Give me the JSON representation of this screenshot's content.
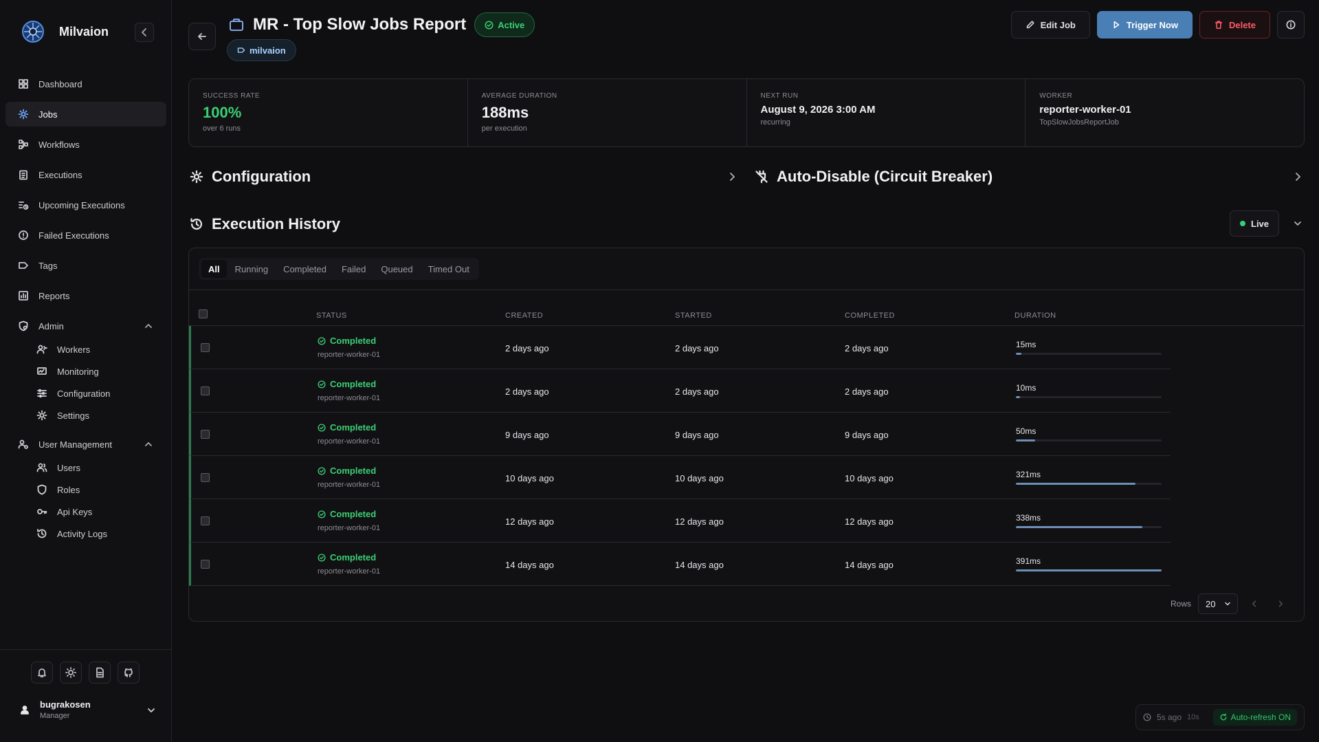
{
  "app": {
    "name": "Milvaion"
  },
  "sidebar": {
    "items": [
      {
        "label": "Dashboard"
      },
      {
        "label": "Jobs"
      },
      {
        "label": "Workflows"
      },
      {
        "label": "Executions"
      },
      {
        "label": "Upcoming Executions"
      },
      {
        "label": "Failed Executions"
      },
      {
        "label": "Tags"
      },
      {
        "label": "Reports"
      }
    ],
    "admin": {
      "label": "Admin",
      "items": [
        {
          "label": "Workers"
        },
        {
          "label": "Monitoring"
        },
        {
          "label": "Configuration"
        },
        {
          "label": "Settings"
        }
      ]
    },
    "user_management": {
      "label": "User Management",
      "items": [
        {
          "label": "Users"
        },
        {
          "label": "Roles"
        },
        {
          "label": "Api Keys"
        },
        {
          "label": "Activity Logs"
        }
      ]
    },
    "user": {
      "name": "bugrakosen",
      "role": "Manager"
    }
  },
  "header": {
    "title": "MR - Top Slow Jobs Report",
    "status": "Active",
    "tag": "milvaion",
    "actions": {
      "edit": "Edit Job",
      "trigger": "Trigger Now",
      "delete": "Delete"
    }
  },
  "stats": [
    {
      "label": "Success Rate",
      "value": "100%",
      "sub": "over 6 runs"
    },
    {
      "label": "Average Duration",
      "value": "188ms",
      "sub": "per execution"
    },
    {
      "label": "Next Run",
      "value": "August 9, 2026 3:00 AM",
      "sub": "recurring"
    },
    {
      "label": "Worker",
      "value": "reporter-worker-01",
      "sub": "TopSlowJobsReportJob"
    }
  ],
  "sections": {
    "configuration": "Configuration",
    "auto_disable": "Auto-Disable (Circuit Breaker)",
    "history": "Execution History",
    "live": "Live"
  },
  "filters": [
    "All",
    "Running",
    "Completed",
    "Failed",
    "Queued",
    "Timed Out"
  ],
  "table": {
    "columns": {
      "status": "Status",
      "created": "Created",
      "started": "Started",
      "completed": "Completed",
      "duration": "Duration"
    },
    "rows": [
      {
        "status": "Completed",
        "worker": "reporter-worker-01",
        "created": "2 days ago",
        "started": "2 days ago",
        "completed": "2 days ago",
        "duration": "15ms",
        "duration_fraction": 0.04
      },
      {
        "status": "Completed",
        "worker": "reporter-worker-01",
        "created": "2 days ago",
        "started": "2 days ago",
        "completed": "2 days ago",
        "duration": "10ms",
        "duration_fraction": 0.03
      },
      {
        "status": "Completed",
        "worker": "reporter-worker-01",
        "created": "9 days ago",
        "started": "9 days ago",
        "completed": "9 days ago",
        "duration": "50ms",
        "duration_fraction": 0.13
      },
      {
        "status": "Completed",
        "worker": "reporter-worker-01",
        "created": "10 days ago",
        "started": "10 days ago",
        "completed": "10 days ago",
        "duration": "321ms",
        "duration_fraction": 0.82
      },
      {
        "status": "Completed",
        "worker": "reporter-worker-01",
        "created": "12 days ago",
        "started": "12 days ago",
        "completed": "12 days ago",
        "duration": "338ms",
        "duration_fraction": 0.87
      },
      {
        "status": "Completed",
        "worker": "reporter-worker-01",
        "created": "14 days ago",
        "started": "14 days ago",
        "completed": "14 days ago",
        "duration": "391ms",
        "duration_fraction": 1.0
      }
    ]
  },
  "pager": {
    "rows_label": "Rows",
    "rows_value": "20"
  },
  "refresh": {
    "last": "5s ago",
    "interval": "10s",
    "status": "Auto-refresh ON"
  },
  "colors": {
    "accent": "#4a7fb5",
    "success": "#3ccf74",
    "danger": "#ff5a67"
  }
}
